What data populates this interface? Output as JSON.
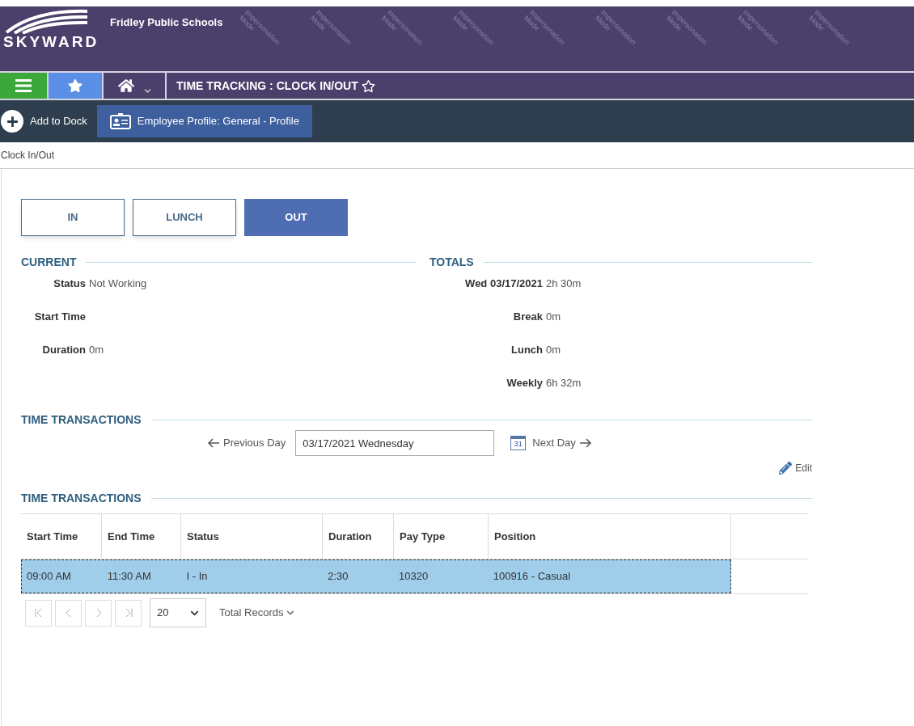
{
  "header": {
    "logo_text": "SKYWARD",
    "district": "Fridley Public Schools",
    "marks": [
      "Impersonation Mode",
      "Impersonation Mode",
      "Impersonation Mode",
      "Impersonation Mode",
      "Impersonation Mode",
      "Impersonation Mode",
      "Impersonation Mode",
      "Impersonation Mode",
      "Impersonation Mode"
    ]
  },
  "nav": {
    "title": "TIME TRACKING : CLOCK IN/OUT",
    "favorite": false
  },
  "dock": {
    "add_label": "Add to Dock",
    "items": [
      {
        "label": "Employee Profile: General - Profile"
      }
    ]
  },
  "breadcrumb": "Clock In/Out",
  "clock_buttons": [
    {
      "label": "IN",
      "selected": false
    },
    {
      "label": "LUNCH",
      "selected": false
    },
    {
      "label": "OUT",
      "selected": true
    }
  ],
  "current": {
    "heading": "CURRENT",
    "fields": [
      {
        "label": "Status",
        "value": "Not Working"
      },
      {
        "label": "Start Time"
      },
      {
        "label": "Duration",
        "value": "0m"
      }
    ]
  },
  "totals": {
    "heading": "TOTALS",
    "fields": [
      {
        "label": "Wed 03/17/2021",
        "value": "2h 30m"
      },
      {
        "label": "Break",
        "value": "0m"
      },
      {
        "label": "Lunch",
        "value": "0m"
      },
      {
        "label": "Weekly",
        "value": "6h 32m"
      }
    ]
  },
  "transactions": {
    "heading": "TIME TRANSACTIONS",
    "previous": "Previous Day",
    "date": "03/17/2021 Wednesday",
    "calendar_day": "31",
    "next": "Next Day",
    "edit": "Edit"
  },
  "table": {
    "heading": "TIME TRANSACTIONS",
    "columns": [
      "Start Time",
      "End Time",
      "Status",
      "Duration",
      "Pay Type",
      "Position"
    ],
    "rows": [
      {
        "cells": [
          "09:00 AM",
          "11:30 AM",
          "I - In",
          "2:30",
          "10320",
          "100916 - Casual"
        ],
        "selected": true
      }
    ],
    "page_size": "20",
    "total_records": "Total Records"
  }
}
